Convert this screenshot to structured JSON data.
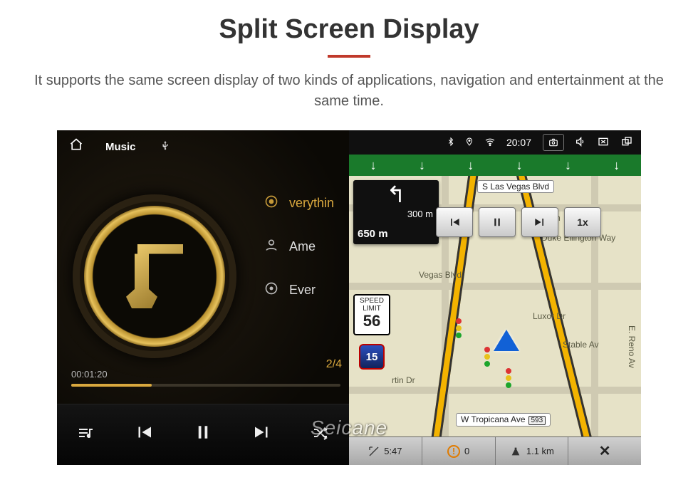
{
  "header": {
    "title": "Split Screen Display",
    "description": "It supports the same screen display of two kinds of applications, navigation and entertainment at the same time."
  },
  "music": {
    "topbar": {
      "label": "Music"
    },
    "tracks": [
      {
        "label": "verythin"
      },
      {
        "label": "Ame"
      },
      {
        "label": "Ever"
      }
    ],
    "counter": "2/4",
    "time": {
      "elapsed": "00:01:20",
      "total": ""
    },
    "progress_pct": 30
  },
  "status": {
    "time": "20:07"
  },
  "nav": {
    "turn": {
      "dist_next": "300 m",
      "dist_total": "650 m"
    },
    "speed": {
      "label": "SPEED LIMIT",
      "value": "56"
    },
    "route_shield": "15",
    "controls": {
      "speed_factor": "1x"
    },
    "labels": {
      "top_road": "S Las Vegas Blvd",
      "bottom_road": "W Tropicana Ave",
      "bottom_badge": "593"
    },
    "streets": {
      "koval": "Koval Ln",
      "duke": "Duke Ellington Way",
      "vegas_blvd": "Vegas Blvd",
      "luxor": "Luxor Dr",
      "stable": "Stable Av",
      "reno": "E. Reno Av",
      "martin": "rtin Dr"
    },
    "bottom": {
      "time_est": "5:47",
      "eta_badge": "0",
      "distance": "1.1 km"
    }
  },
  "watermark": "Seicane"
}
